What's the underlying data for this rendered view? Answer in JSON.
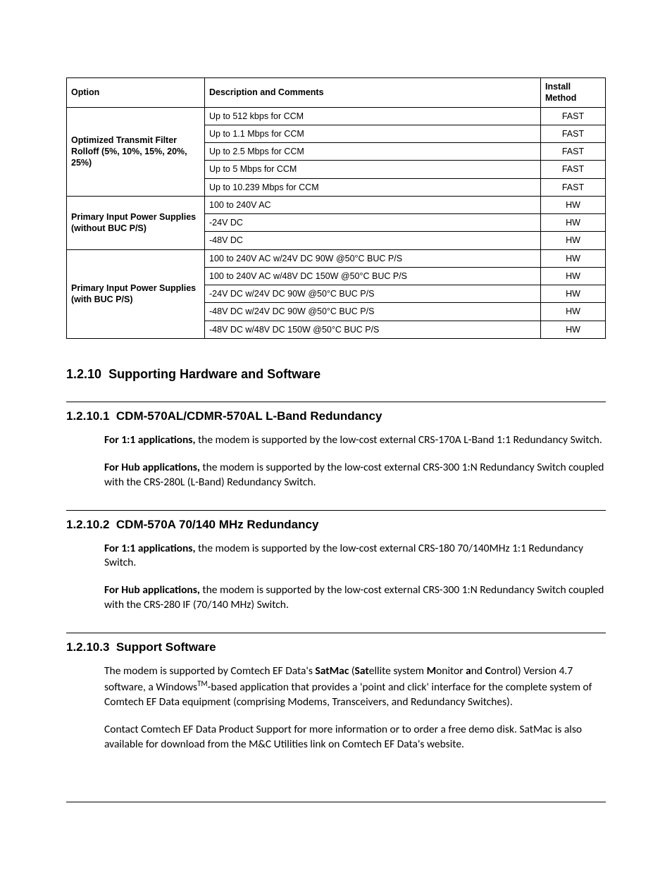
{
  "table": {
    "headers": {
      "option": "Option",
      "desc": "Description and Comments",
      "install": "Install Method"
    },
    "groups": [
      {
        "option": "Optimized Transmit Filter Rolloff (5%, 10%, 15%, 20%, 25%)",
        "rows": [
          {
            "desc": "Up to 512 kbps for CCM",
            "install": "FAST"
          },
          {
            "desc": "Up to 1.1 Mbps for CCM",
            "install": "FAST"
          },
          {
            "desc": "Up to 2.5 Mbps for CCM",
            "install": "FAST"
          },
          {
            "desc": "Up to 5 Mbps for CCM",
            "install": "FAST"
          },
          {
            "desc": "Up to 10.239 Mbps for CCM",
            "install": "FAST"
          }
        ]
      },
      {
        "option": "Primary Input Power Supplies (without BUC P/S)",
        "rows": [
          {
            "desc": "100 to 240V AC",
            "install": "HW"
          },
          {
            "desc": "-24V DC",
            "install": "HW"
          },
          {
            "desc": "-48V DC",
            "install": "HW"
          }
        ]
      },
      {
        "option": "Primary Input Power Supplies (with BUC P/S)",
        "rows": [
          {
            "desc": "100 to 240V AC w/24V DC 90W @50°C BUC P/S",
            "install": "HW"
          },
          {
            "desc": "100 to 240V AC w/48V DC 150W @50°C BUC P/S",
            "install": "HW"
          },
          {
            "desc": "-24V DC w/24V DC 90W @50°C BUC P/S",
            "install": "HW"
          },
          {
            "desc": "-48V DC w/24V DC 90W @50°C BUC P/S",
            "install": "HW"
          },
          {
            "desc": "-48V DC w/48V DC 150W @50°C BUC P/S",
            "install": "HW"
          }
        ]
      }
    ]
  },
  "sections": {
    "s1": {
      "num": "1.2.10",
      "title": "Supporting Hardware and Software"
    },
    "s11": {
      "num": "1.2.10.1",
      "title": "CDM-570AL/CDMR-570AL L-Band Redundancy",
      "p1_lead": "For 1:1 applications,",
      "p1_rest": " the modem is supported by the low-cost external CRS-170A L-Band 1:1 Redundancy Switch.",
      "p2_lead": "For Hub applications,",
      "p2_rest": " the modem is supported by the low-cost external CRS-300 1:N Redundancy Switch coupled with the CRS-280L (L-Band) Redundancy Switch."
    },
    "s12": {
      "num": "1.2.10.2",
      "title": "CDM-570A 70/140 MHz Redundancy",
      "p1_lead": "For 1:1 applications,",
      "p1_rest": " the modem is supported by the low-cost external CRS-180 70/140MHz 1:1 Redundancy Switch.",
      "p2_lead": "For Hub applications,",
      "p2_rest": " the modem is supported by the low-cost external CRS-300 1:N Redundancy Switch coupled with the CRS-280 IF (70/140 MHz) Switch."
    },
    "s13": {
      "num": "1.2.10.3",
      "title": "Support Software",
      "p1_a": "The modem is supported by Comtech EF Data's ",
      "p1_b": "SatMac",
      "p1_c": " (",
      "p1_d": "Sat",
      "p1_e": "ellite system ",
      "p1_f": "M",
      "p1_g": "onitor ",
      "p1_h": "a",
      "p1_i": "nd ",
      "p1_j": "C",
      "p1_k": "ontrol) Version 4.7 software, a Windows",
      "p1_tm": "TM",
      "p1_l": "-based application that provides a 'point and click' interface for the complete system of Comtech EF Data equipment (comprising Modems, Transceivers, and Redundancy Switches).",
      "p2": "Contact Comtech EF Data Product Support for more information or to order a free demo disk. SatMac is also available for download from the M&C Utilities link on Comtech EF Data's website."
    }
  }
}
